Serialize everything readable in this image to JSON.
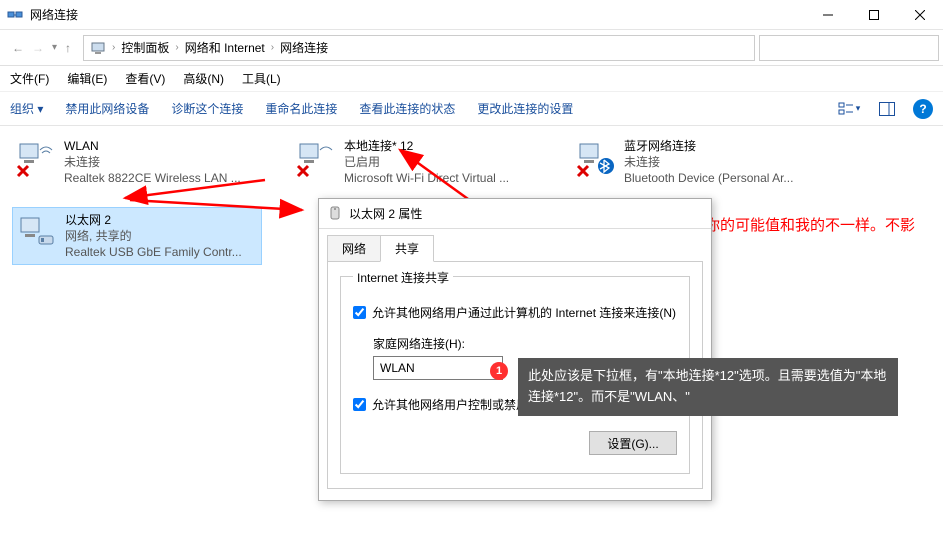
{
  "window": {
    "title": "网络连接"
  },
  "breadcrumbs": {
    "root_icon": "pc",
    "c1": "控制面板",
    "c2": "网络和 Internet",
    "c3": "网络连接"
  },
  "search": {
    "placeholder": ""
  },
  "menubar": {
    "file": "文件(F)",
    "edit": "编辑(E)",
    "view": "查看(V)",
    "advanced": "高级(N)",
    "tools": "工具(L)"
  },
  "toolbar": {
    "organize": "组织 ▾",
    "disable": "禁用此网络设备",
    "diagnose": "诊断这个连接",
    "rename": "重命名此连接",
    "status": "查看此连接的状态",
    "change": "更改此连接的设置"
  },
  "connections": [
    {
      "name": "WLAN",
      "status": "未连接",
      "device": "Realtek 8822CE Wireless LAN ...",
      "badge": "x"
    },
    {
      "name": "本地连接* 12",
      "status": "已启用",
      "device": "Microsoft Wi-Fi Direct Virtual ...",
      "badge": "x"
    },
    {
      "name": "蓝牙网络连接",
      "status": "未连接",
      "device": "Bluetooth Device (Personal Ar...",
      "badge": "x",
      "bt": true
    },
    {
      "name": "以太网 2",
      "status": "网络, 共享的",
      "device": "Realtek USB GbE Family Contr...",
      "selected": true
    }
  ],
  "dialog": {
    "title": "以太网 2 属性",
    "tabs": {
      "network": "网络",
      "sharing": "共享"
    },
    "group_title": "Internet 连接共享",
    "chk1": "允许其他网络用户通过此计算机的 Internet 连接来连接(N)",
    "home_label": "家庭网络连接(H):",
    "combo_value": "WLAN",
    "chk2": "允许其他网络用户控制或禁用共享的 Internet 连接(O)",
    "settings_btn": "设置(G)..."
  },
  "annotations": {
    "arrow_note": "下面框中值为此箭头所指数值，你的可能值和我的不一样。不影响。",
    "badge": "1",
    "tooltip": "此处应该是下拉框，有\"本地连接*12\"选项。且需要选值为\"本地连接*12\"。而不是\"WLAN、\""
  }
}
